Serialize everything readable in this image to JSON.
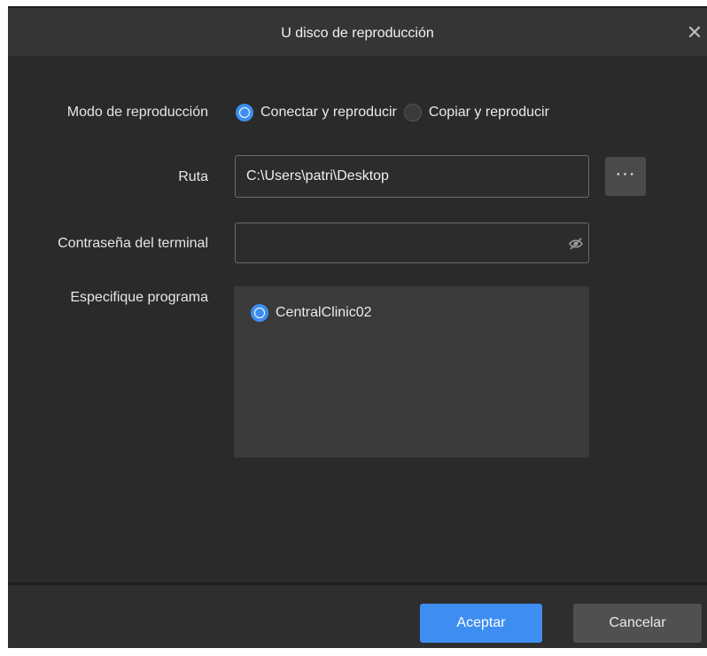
{
  "dialog": {
    "title": "U disco de reproducción",
    "close_symbol": "✕"
  },
  "playback_mode": {
    "label": "Modo de reproducción",
    "options": [
      {
        "label": "Conectar y reproducir",
        "selected": true
      },
      {
        "label": "Copiar y reproducir",
        "selected": false
      }
    ]
  },
  "path": {
    "label": "Ruta",
    "value": "C:\\Users\\patri\\Desktop",
    "browse_label": "···"
  },
  "password": {
    "label": "Contraseña del terminal",
    "value": "",
    "visibility_icon": "eye-slash-icon"
  },
  "program": {
    "label": "Especifique programa",
    "items": [
      {
        "label": "CentralClinic02",
        "selected": true
      }
    ]
  },
  "footer": {
    "ok_label": "Aceptar",
    "cancel_label": "Cancelar"
  },
  "colors": {
    "accent": "#3d8ef0",
    "background": "#2a2a2a",
    "titlebar": "#353535"
  }
}
